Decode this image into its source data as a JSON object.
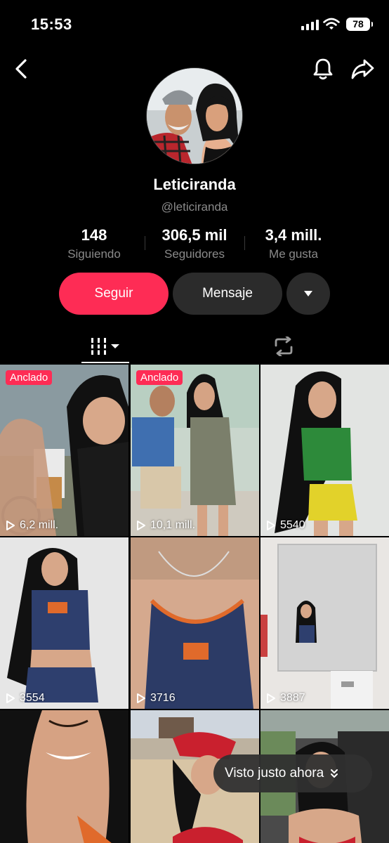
{
  "status": {
    "time": "15:53",
    "battery": "78"
  },
  "profile": {
    "display_name": "Leticiranda",
    "username": "@leticiranda"
  },
  "stats": [
    {
      "value": "148",
      "label": "Siguiendo"
    },
    {
      "value": "306,5 mil",
      "label": "Seguidores"
    },
    {
      "value": "3,4 mill.",
      "label": "Me gusta"
    }
  ],
  "actions": {
    "follow": "Seguir",
    "message": "Mensaje"
  },
  "colors": {
    "accent": "#fe2c55",
    "background": "#000000",
    "secondary_button": "#2b2b2b"
  },
  "videos": [
    {
      "pinned_label": "Anclado",
      "views": "6,2 mill."
    },
    {
      "pinned_label": "Anclado",
      "views": "10,1 mill."
    },
    {
      "pinned_label": "",
      "views": "5540"
    },
    {
      "pinned_label": "",
      "views": "3554"
    },
    {
      "pinned_label": "",
      "views": "3716"
    },
    {
      "pinned_label": "",
      "views": "3887"
    },
    {
      "pinned_label": "",
      "views": ""
    },
    {
      "pinned_label": "",
      "views": ""
    },
    {
      "pinned_label": "",
      "views": ""
    }
  ],
  "toast": {
    "text": "Visto justo ahora"
  }
}
